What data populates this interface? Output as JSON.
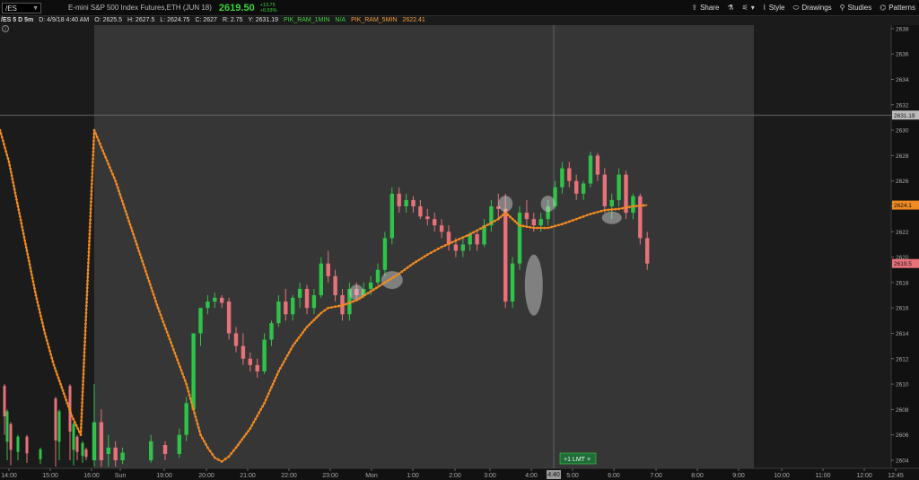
{
  "header": {
    "symbol": "/ES",
    "description": "E-mini S&P 500 Index Futures,ETH (JUN 18)",
    "last_price": "2619.50",
    "change": "+13.75",
    "change_pct": "+0.53%",
    "tools": [
      {
        "icon": "share-icon",
        "label": "Share"
      },
      {
        "icon": "flask-icon",
        "label": ""
      },
      {
        "icon": "settings-icon",
        "label": ""
      },
      {
        "icon": "style-icon",
        "label": "Style"
      },
      {
        "icon": "drawings-icon",
        "label": "Drawings"
      },
      {
        "icon": "studies-icon",
        "label": "Studies"
      },
      {
        "icon": "patterns-icon",
        "label": "Patterns"
      }
    ]
  },
  "info": {
    "title": "/ES 5 D 5m",
    "date": "D: 4/9/18 4:40 AM",
    "open": "O: 2625.5",
    "high": "H: 2627.5",
    "low": "L: 2624.75",
    "close": "C: 2627",
    "range": "R: 2.75",
    "y": "Y: 2631.19",
    "study1": "PIK_RAM_1MIN",
    "study1_val": "N/A",
    "study2": "PIK_RAM_5MIN",
    "study2_val": "2622.41"
  },
  "colors": {
    "up": "#2fc34a",
    "down": "#e8727a",
    "ma": "#f08a22",
    "session_bg": "#363636",
    "outside_bg": "#1b1b1b"
  },
  "chart_data": {
    "type": "candlestick",
    "y_ticks": [
      "2638",
      "2636",
      "2634",
      "2632",
      "2630",
      "2628",
      "2626",
      "2624",
      "2622",
      "2620",
      "2618",
      "2616",
      "2614",
      "2612",
      "2610",
      "2608",
      "2606",
      "2604"
    ],
    "ylim": [
      2603.5,
      2639
    ],
    "x_ticks": [
      "14:00",
      "15:00",
      "16:00",
      "Sun",
      "19:00",
      "20:00",
      "21:00",
      "22:00",
      "23:00",
      "Mon",
      "1:00",
      "2:00",
      "3:00",
      "4:00",
      "5:00",
      "6:00",
      "7:00",
      "8:00",
      "9:00",
      "10:00",
      "11:00",
      "12:00",
      "12:45"
    ],
    "crosshair_price_label": "2631.19",
    "crosshair_time_label": "4:40",
    "last_price_label": "2619.5",
    "ma_price_label": "2624.1",
    "order_label": "+1 LMT",
    "ma_points": [
      [
        0,
        2630
      ],
      [
        3,
        2626
      ],
      [
        6,
        2621
      ],
      [
        9,
        2616
      ],
      [
        11,
        2613
      ],
      [
        13,
        2610
      ],
      [
        14,
        2608
      ],
      [
        15,
        2606
      ],
      [
        16,
        2605
      ],
      [
        17,
        2604.2
      ],
      [
        18,
        2603.9
      ],
      [
        19,
        2604.3
      ],
      [
        20,
        2605
      ],
      [
        22,
        2606.5
      ],
      [
        24,
        2608.5
      ],
      [
        26,
        2611
      ],
      [
        28,
        2613
      ],
      [
        30,
        2614.5
      ],
      [
        32,
        2615.6
      ],
      [
        33,
        2616
      ],
      [
        35,
        2616.2
      ],
      [
        37,
        2616.6
      ],
      [
        39,
        2617.3
      ],
      [
        41,
        2618
      ],
      [
        43,
        2618.7
      ],
      [
        45,
        2619.5
      ],
      [
        47,
        2620.2
      ],
      [
        49,
        2620.8
      ],
      [
        51,
        2621.3
      ],
      [
        53,
        2621.8
      ],
      [
        55,
        2622.4
      ],
      [
        57,
        2623
      ],
      [
        58,
        2623.5
      ],
      [
        59,
        2623
      ],
      [
        60,
        2622.5
      ],
      [
        62,
        2622.3
      ],
      [
        64,
        2622.3
      ],
      [
        66,
        2622.6
      ],
      [
        68,
        2623
      ],
      [
        70,
        2623.4
      ],
      [
        72,
        2623.7
      ],
      [
        74,
        2623.8
      ],
      [
        76,
        2624
      ],
      [
        78,
        2624.1
      ]
    ],
    "candles": [
      [
        0,
        2604,
        2610,
        2603.5,
        2607
      ],
      [
        1,
        2607,
        2608,
        2603.5,
        2604
      ],
      [
        2,
        2604.5,
        2606,
        2603.5,
        2605
      ],
      [
        3,
        2605,
        2605.5,
        2603.5,
        2604
      ],
      [
        4,
        2604,
        2605,
        2603.7,
        2604.6
      ],
      [
        8,
        2604,
        2606,
        2603.8,
        2605.5
      ],
      [
        10,
        2605.2,
        2605.5,
        2604,
        2604.5
      ],
      [
        12,
        2604.5,
        2606.5,
        2604.2,
        2606
      ],
      [
        13,
        2606,
        2609,
        2605.5,
        2608.5
      ],
      [
        14,
        2608,
        2614,
        2608,
        2614
      ],
      [
        15,
        2614,
        2616,
        2613,
        2616
      ],
      [
        16,
        2616,
        2617,
        2615.5,
        2616.5
      ],
      [
        17,
        2616.5,
        2617.2,
        2616,
        2616.8
      ],
      [
        18,
        2616.8,
        2617,
        2616,
        2616.4
      ],
      [
        19,
        2616.5,
        2616.8,
        2613.5,
        2614
      ],
      [
        20,
        2614,
        2614.5,
        2612.5,
        2613
      ],
      [
        21,
        2613,
        2614,
        2611.5,
        2612
      ],
      [
        22,
        2612,
        2612.5,
        2611,
        2611.5
      ],
      [
        23,
        2611.5,
        2612,
        2610.5,
        2611
      ],
      [
        24,
        2611,
        2614,
        2610.8,
        2613.5
      ],
      [
        25,
        2613.5,
        2615,
        2613,
        2614.8
      ],
      [
        26,
        2614.8,
        2617,
        2614.5,
        2616.5
      ],
      [
        27,
        2616.5,
        2617.5,
        2615,
        2615.5
      ],
      [
        28,
        2615.5,
        2617,
        2615,
        2616.8
      ],
      [
        29,
        2616.8,
        2618,
        2616,
        2617.5
      ],
      [
        30,
        2617.5,
        2617.8,
        2615.5,
        2616
      ],
      [
        31,
        2616,
        2617.5,
        2615.5,
        2617
      ],
      [
        32,
        2617,
        2620,
        2616.8,
        2619.5
      ],
      [
        33,
        2619.5,
        2620.5,
        2618,
        2618.5
      ],
      [
        34,
        2618.5,
        2619,
        2616.5,
        2617
      ],
      [
        35,
        2617,
        2617.5,
        2615,
        2615.5
      ],
      [
        36,
        2615.5,
        2618,
        2615,
        2617.5
      ],
      [
        37,
        2617.5,
        2618,
        2616.5,
        2617
      ],
      [
        38,
        2617,
        2618,
        2616.8,
        2617.5
      ],
      [
        39,
        2617.5,
        2618.5,
        2617,
        2618
      ],
      [
        40,
        2618,
        2619.5,
        2617.8,
        2619
      ],
      [
        41,
        2619,
        2622,
        2618.5,
        2621.5
      ],
      [
        42,
        2621.5,
        2625.5,
        2621,
        2625
      ],
      [
        43,
        2625,
        2625.5,
        2623.5,
        2624
      ],
      [
        44,
        2624,
        2625,
        2623.5,
        2624.5
      ],
      [
        45,
        2624.5,
        2624.8,
        2623.5,
        2624
      ],
      [
        46,
        2624,
        2624.5,
        2623,
        2623.2
      ],
      [
        47,
        2623.2,
        2623.8,
        2622.5,
        2623
      ],
      [
        48,
        2623,
        2623.5,
        2622,
        2622.5
      ],
      [
        49,
        2622.5,
        2623,
        2621.5,
        2622
      ],
      [
        50,
        2622,
        2622.5,
        2620.5,
        2621
      ],
      [
        51,
        2621,
        2621.5,
        2620,
        2620.5
      ],
      [
        52,
        2620.5,
        2621.5,
        2620,
        2621
      ],
      [
        53,
        2621,
        2622,
        2620.5,
        2621.8
      ],
      [
        54,
        2621.8,
        2622,
        2620.5,
        2621
      ],
      [
        55,
        2621,
        2623,
        2620.8,
        2622.5
      ],
      [
        56,
        2622.5,
        2624.5,
        2622,
        2624
      ],
      [
        57,
        2624,
        2625,
        2623,
        2623.8
      ],
      [
        58,
        2623.8,
        2625,
        2616,
        2616.5
      ],
      [
        59,
        2616.5,
        2620,
        2616,
        2619.5
      ],
      [
        60,
        2619.5,
        2624,
        2619,
        2623.5
      ],
      [
        61,
        2623.5,
        2624.5,
        2622.5,
        2623
      ],
      [
        62,
        2623,
        2623.5,
        2622,
        2622.5
      ],
      [
        63,
        2622.5,
        2623.5,
        2622,
        2623
      ],
      [
        64,
        2623,
        2624.5,
        2622.5,
        2624
      ],
      [
        65,
        2624,
        2626,
        2623.8,
        2625.5
      ],
      [
        66,
        2625.5,
        2627.5,
        2625,
        2627
      ],
      [
        67,
        2627,
        2627.5,
        2625.5,
        2626
      ],
      [
        68,
        2626,
        2626.5,
        2624.5,
        2625
      ],
      [
        69,
        2625,
        2626,
        2624.5,
        2625.8
      ],
      [
        70,
        2625.8,
        2628.3,
        2625.5,
        2628
      ],
      [
        71,
        2628,
        2628.2,
        2626,
        2626.5
      ],
      [
        72,
        2626.5,
        2627,
        2623.5,
        2624
      ],
      [
        73,
        2624,
        2625,
        2623,
        2624.5
      ],
      [
        74,
        2624.5,
        2627,
        2624,
        2626.5
      ],
      [
        75,
        2626.5,
        2626.8,
        2623,
        2623.5
      ],
      [
        76,
        2623.5,
        2625,
        2623,
        2624.8
      ],
      [
        77,
        2624.8,
        2625,
        2621,
        2621.5
      ],
      [
        78,
        2621.5,
        2622,
        2619,
        2619.5
      ]
    ],
    "highlight_marks": [
      {
        "i": 37,
        "p": 2617.2,
        "size": "s"
      },
      {
        "i": 42,
        "p": 2618.2,
        "size": "m"
      },
      {
        "i": 58,
        "p": 2624.2,
        "size": "s"
      },
      {
        "i": 62,
        "p": 2617.8,
        "size": "l"
      },
      {
        "i": 64,
        "p": 2624.2,
        "size": "s"
      },
      {
        "i": 73,
        "p": 2623.1,
        "size": "w"
      }
    ]
  }
}
